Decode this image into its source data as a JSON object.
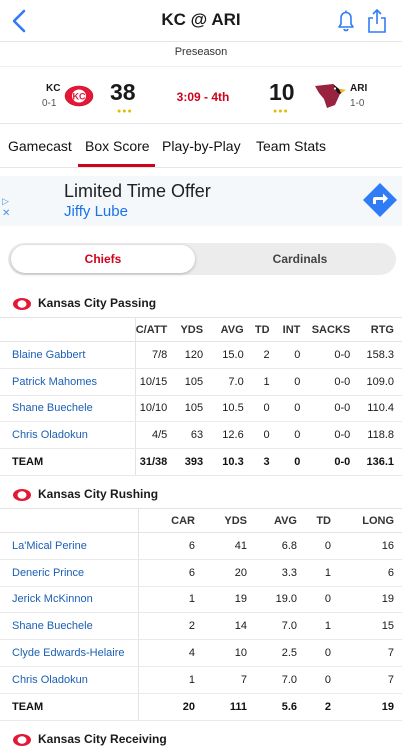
{
  "header": {
    "title": "KC @ ARI",
    "subtitle": "Preseason"
  },
  "game": {
    "away": {
      "abbr": "KC",
      "record": "0-1",
      "score": "38",
      "timeouts": "●●●"
    },
    "home": {
      "abbr": "ARI",
      "record": "1-0",
      "score": "10",
      "timeouts": "●●●"
    },
    "clock": "3:09 - 4th"
  },
  "tabs": [
    "Gamecast",
    "Box Score",
    "Play-by-Play",
    "Team Stats"
  ],
  "ad": {
    "title": "Limited Time Offer",
    "advertiser": "Jiffy Lube",
    "play_glyph": "▷",
    "close_glyph": "✕"
  },
  "team_toggle": {
    "active": "Chiefs",
    "inactive": "Cardinals"
  },
  "passing": {
    "title": "Kansas City Passing",
    "headers": [
      "",
      "C/ATT",
      "YDS",
      "AVG",
      "TD",
      "INT",
      "SACKS",
      "RTG"
    ],
    "rows": [
      [
        "Blaine Gabbert",
        "7/8",
        "120",
        "15.0",
        "2",
        "0",
        "0-0",
        "158.3"
      ],
      [
        "Patrick Mahomes",
        "10/15",
        "105",
        "7.0",
        "1",
        "0",
        "0-0",
        "109.0"
      ],
      [
        "Shane Buechele",
        "10/10",
        "105",
        "10.5",
        "0",
        "0",
        "0-0",
        "110.4"
      ],
      [
        "Chris Oladokun",
        "4/5",
        "63",
        "12.6",
        "0",
        "0",
        "0-0",
        "118.8"
      ]
    ],
    "team": [
      "TEAM",
      "31/38",
      "393",
      "10.3",
      "3",
      "0",
      "0-0",
      "136.1"
    ]
  },
  "rushing": {
    "title": "Kansas City Rushing",
    "headers": [
      "",
      "CAR",
      "YDS",
      "AVG",
      "TD",
      "LONG"
    ],
    "rows": [
      [
        "La'Mical Perine",
        "6",
        "41",
        "6.8",
        "0",
        "16"
      ],
      [
        "Deneric Prince",
        "6",
        "20",
        "3.3",
        "1",
        "6"
      ],
      [
        "Jerick McKinnon",
        "1",
        "19",
        "19.0",
        "0",
        "19"
      ],
      [
        "Shane Buechele",
        "2",
        "14",
        "7.0",
        "1",
        "15"
      ],
      [
        "Clyde Edwards-Helaire",
        "4",
        "10",
        "2.5",
        "0",
        "7"
      ],
      [
        "Chris Oladokun",
        "1",
        "7",
        "7.0",
        "0",
        "7"
      ]
    ],
    "team": [
      "TEAM",
      "20",
      "111",
      "5.6",
      "2",
      "19"
    ]
  },
  "receiving": {
    "title": "Kansas City Receiving"
  },
  "colors": {
    "accent": "#d0021b",
    "link": "#1a5fb4",
    "ad_link": "#1a73e8",
    "ios_blue": "#2f7cf6"
  },
  "icons": [
    "back-chevron-icon",
    "bell-icon",
    "share-icon",
    "chiefs-logo-icon",
    "cardinals-logo-icon",
    "ad-play-icon",
    "ad-close-icon",
    "ad-arrow-icon"
  ]
}
